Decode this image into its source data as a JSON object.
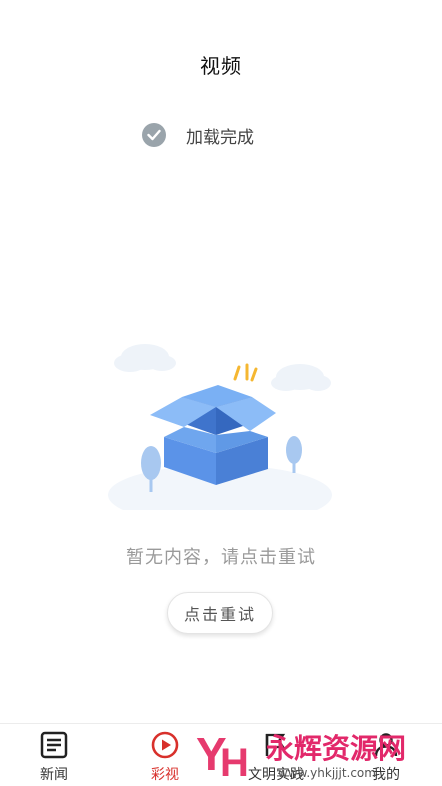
{
  "header": {
    "title": "视频"
  },
  "status": {
    "icon": "check-circle-icon",
    "text": "加载完成"
  },
  "empty_state": {
    "illustration": "empty-box-illustration",
    "message": "暂无内容，请点击重试",
    "retry_label": "点击重试"
  },
  "tabs": [
    {
      "label": "新闻",
      "icon": "news-icon",
      "active": false
    },
    {
      "label": "彩视",
      "icon": "play-circle-icon",
      "active": true
    },
    {
      "label": "文明实践",
      "icon": "flag-icon",
      "active": false
    },
    {
      "label": "我的",
      "icon": "person-icon",
      "active": false
    }
  ],
  "watermark": {
    "logo_text": "YH",
    "brand": "永辉资源网",
    "url": "www.yhkjjjt.com"
  },
  "colors": {
    "accent": "#d8302b",
    "check": "#9aa4ab",
    "box": "#5b93e8"
  }
}
